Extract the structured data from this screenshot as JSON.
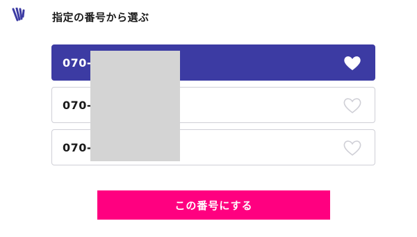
{
  "header": {
    "logo_icon": "brand-logo-icon",
    "title": "指定の番号から選ぶ"
  },
  "numbers": [
    {
      "text": "070-",
      "selected": true,
      "icon": "heart-filled-icon"
    },
    {
      "text": "070-",
      "selected": false,
      "icon": "heart-outline-icon"
    },
    {
      "text": "070-",
      "selected": false,
      "icon": "heart-outline-icon"
    }
  ],
  "confirm_button": {
    "label": "この番号にする"
  },
  "colors": {
    "selected_bg": "#3c3ba3",
    "accent_button": "#ff0080",
    "border": "#cfcfd6",
    "redaction": "#d4d4d4"
  }
}
